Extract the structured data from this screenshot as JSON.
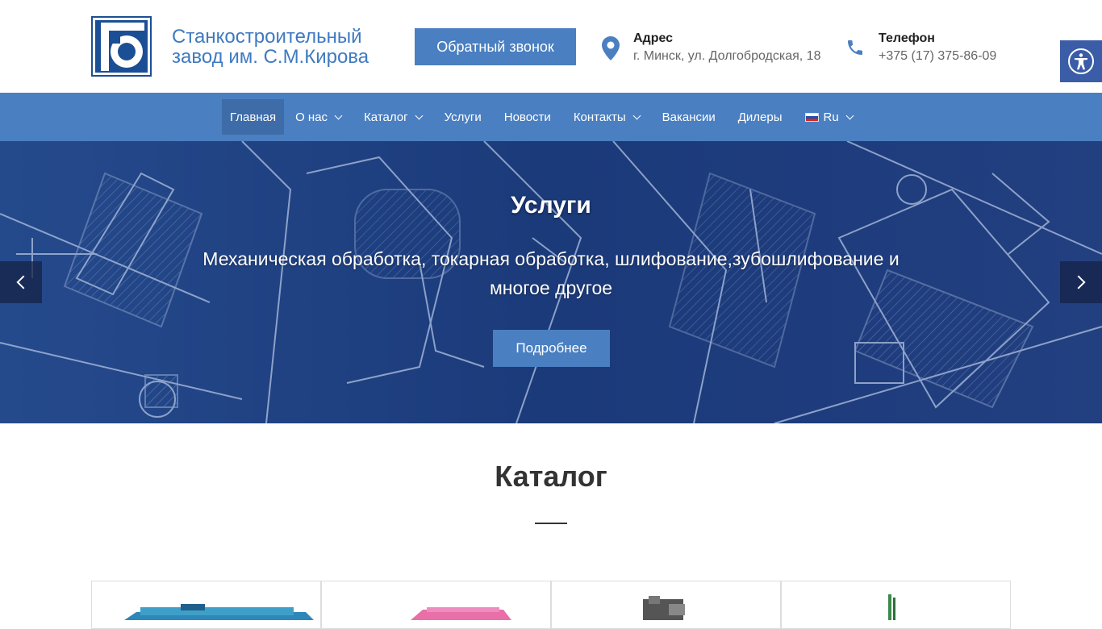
{
  "header": {
    "brand_line1": "Станкостроительный",
    "brand_line2": "завод им. С.М.Кирова",
    "callback_label": "Обратный звонок",
    "address_label": "Адрес",
    "address_value": "г. Минск, ул. Долгобродская, 18",
    "phone_label": "Телефон",
    "phone_value": "+375 (17) 375-86-09"
  },
  "nav": {
    "items": [
      {
        "label": "Главная"
      },
      {
        "label": "О нас"
      },
      {
        "label": "Каталог"
      },
      {
        "label": "Услуги"
      },
      {
        "label": "Новости"
      },
      {
        "label": "Контакты"
      },
      {
        "label": "Вакансии"
      },
      {
        "label": "Дилеры"
      },
      {
        "label": "Ru"
      }
    ]
  },
  "slider": {
    "title": "Услуги",
    "text": "Механическая обработка, токарная обработка, шлифование,зубошлифование и многое другое",
    "button_label": "Подробнее"
  },
  "catalog": {
    "title": "Каталог"
  },
  "colors": {
    "accent": "#4a7fc1",
    "nav_active": "#3d6ca8",
    "slider_bg": "#1c3a78",
    "a11y_bg": "#3b5da8"
  },
  "icons": [
    "logo-icon",
    "location-pin-icon",
    "phone-icon",
    "accessibility-icon",
    "chevron-down-icon",
    "flag-ru-icon",
    "chevron-left-icon",
    "chevron-right-icon"
  ]
}
